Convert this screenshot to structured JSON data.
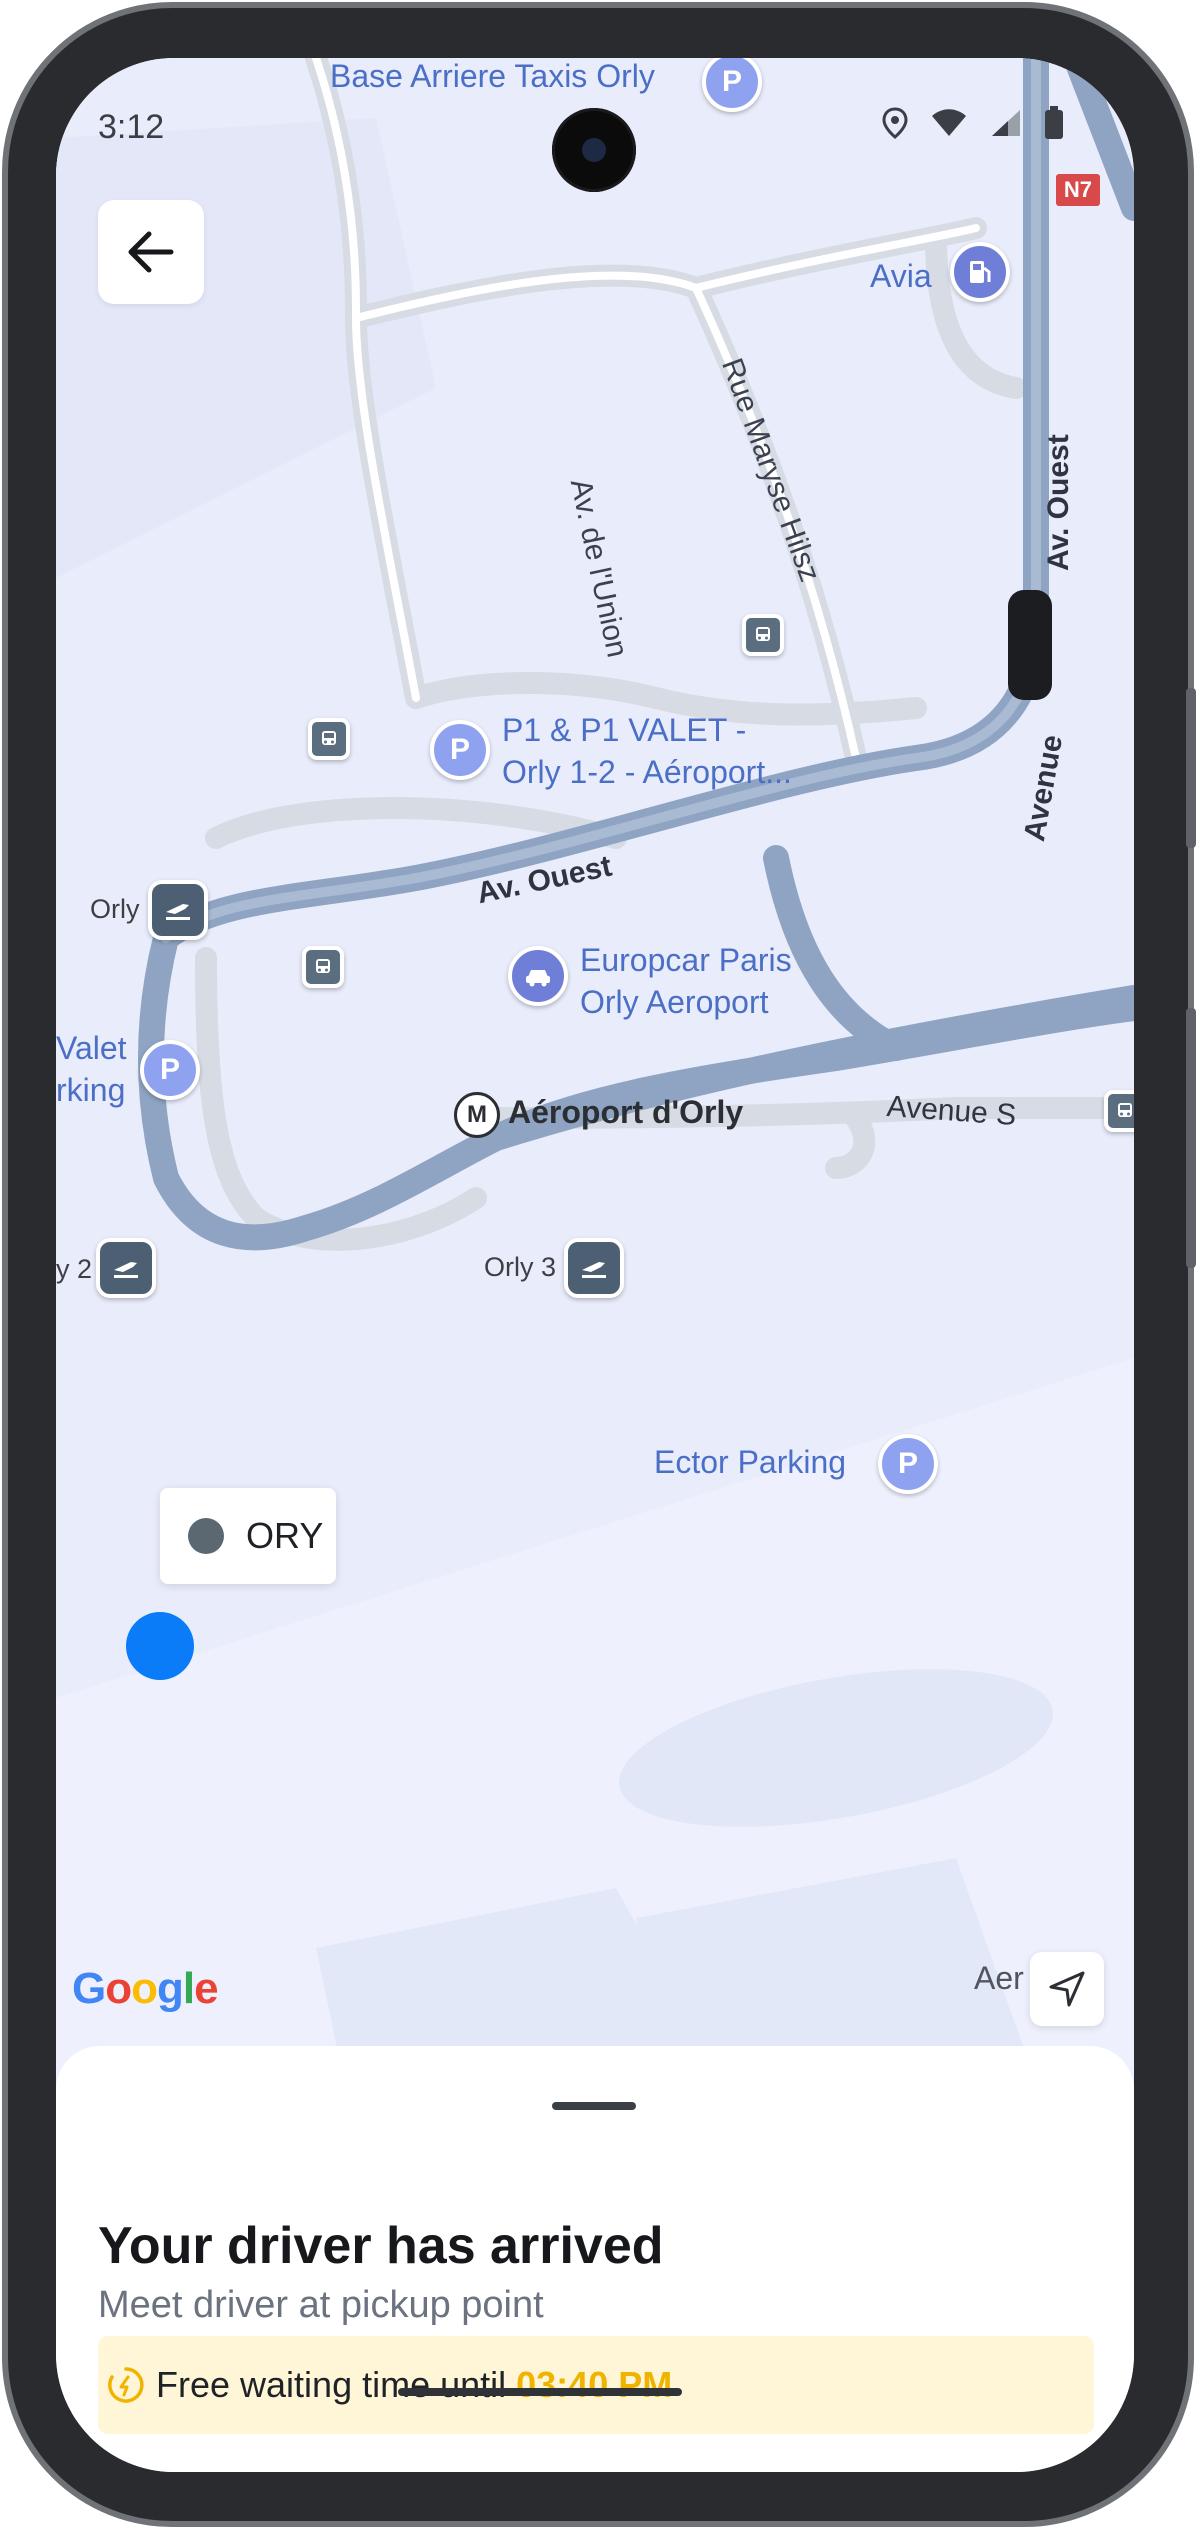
{
  "status_bar": {
    "time": "3:12"
  },
  "map": {
    "labels": {
      "base_arriere": "Base Arriere Taxis Orly",
      "avia": "Avia",
      "rue_maryse": "Rue Maryse Hilsz",
      "av_union": "Av. de l'Union",
      "av_ouest_right": "Av. Ouest",
      "p1_line1": "P1 & P1 VALET -",
      "p1_line2": "Orly 1-2 - Aéroport...",
      "av_ouest_center": "Av. Ouest",
      "avenue_right": "Avenue",
      "orly_left": "Orly",
      "europcar_line1": "Europcar Paris",
      "europcar_line2": "Orly Aeroport",
      "valet_line1": "Valet",
      "valet_line2": "rking",
      "aeroport_orly": "Aéroport d'Orly",
      "avenue_s": "Avenue S",
      "orly2": "y 2",
      "orly3": "Orly 3",
      "ector_parking": "Ector Parking",
      "aero_bottom": "Aer",
      "n7": "N7",
      "p_letter": "P",
      "metro_letter": "M"
    },
    "pickup_card": {
      "label": "ORY"
    },
    "google_logo": "Google"
  },
  "sheet": {
    "title": "Your driver has arrived",
    "subtitle": "Meet driver at pickup point",
    "waiting": {
      "text": "Free waiting time until",
      "time": "03:40 PM"
    }
  },
  "colors": {
    "map_bg": "#e9ecfb",
    "road": "#8ea4c2",
    "road_light": "#d4d9e2",
    "user_dot": "#0a7cf7",
    "accent_yellow": "#f0b400",
    "wait_bg": "#fff6d8"
  }
}
